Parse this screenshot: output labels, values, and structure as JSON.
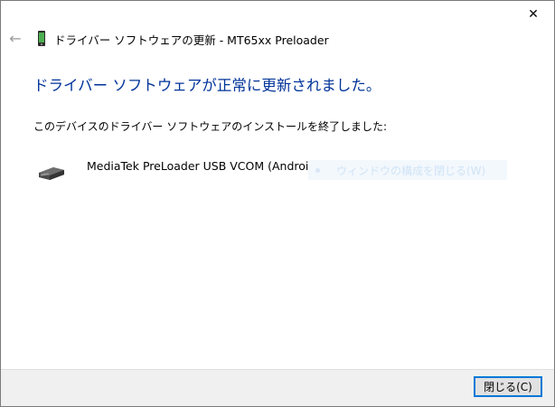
{
  "window": {
    "close_glyph": "✕",
    "back_glyph": "←",
    "title": "ドライバー ソフトウェアの更新 - MT65xx Preloader"
  },
  "main": {
    "heading": "ドライバー ソフトウェアが正常に更新されました。",
    "description": "このデバイスのドライバー ソフトウェアのインストールを終了しました:"
  },
  "device": {
    "name": "MediaTek PreLoader USB VCOM (Android)",
    "icon": "usb-connector-icon"
  },
  "faded_link": {
    "label": "ウィンドウの構成を閉じる(W)"
  },
  "footer": {
    "close_button": "閉じる(C)"
  },
  "colors": {
    "heading": "#003399",
    "button_border": "#0078d7",
    "footer_bg": "#f0f0f0"
  }
}
